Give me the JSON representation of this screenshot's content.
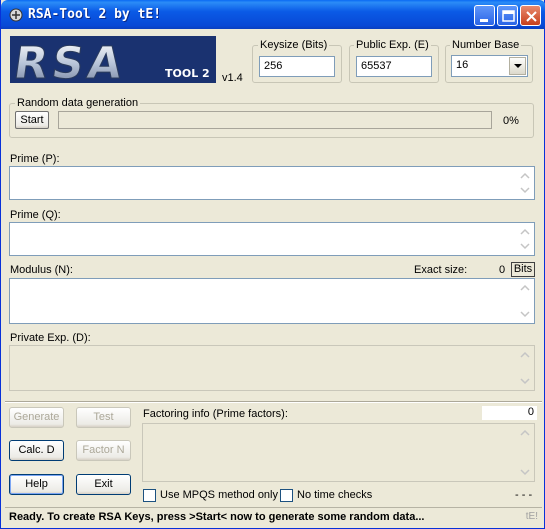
{
  "window": {
    "title": "RSA-Tool 2 by tE!"
  },
  "logo": {
    "big_text": "RSA",
    "small_text": "TOOL 2"
  },
  "version": "v1.4",
  "keysize": {
    "label": "Keysize (Bits)",
    "value": "256"
  },
  "public_exp": {
    "label": "Public Exp. (E)",
    "value": "65537"
  },
  "number_base": {
    "label": "Number Base",
    "value": "16"
  },
  "random": {
    "label": "Random data generation",
    "start_label": "Start",
    "percent": "0%",
    "progress": 0
  },
  "prime_p": {
    "label": "Prime (P):",
    "value": ""
  },
  "prime_q": {
    "label": "Prime (Q):",
    "value": ""
  },
  "modulus": {
    "label": "Modulus (N):",
    "exact_label": "Exact size:",
    "exact_value": "0",
    "bits_label": "Bits",
    "value": ""
  },
  "private_exp": {
    "label": "Private Exp. (D):",
    "value": ""
  },
  "buttons": {
    "generate": "Generate",
    "test": "Test",
    "calc_d": "Calc. D",
    "factor_n": "Factor N",
    "help": "Help",
    "exit": "Exit"
  },
  "factoring": {
    "label": "Factoring info (Prime factors):",
    "count": "0",
    "value": ""
  },
  "options": {
    "mpqs_label": "Use MPQS method only",
    "notime_label": "No time checks",
    "dashes": "- - -"
  },
  "status": {
    "text": "Ready. To create RSA Keys, press >Start< now to generate some random data...",
    "corner": "tE!"
  }
}
